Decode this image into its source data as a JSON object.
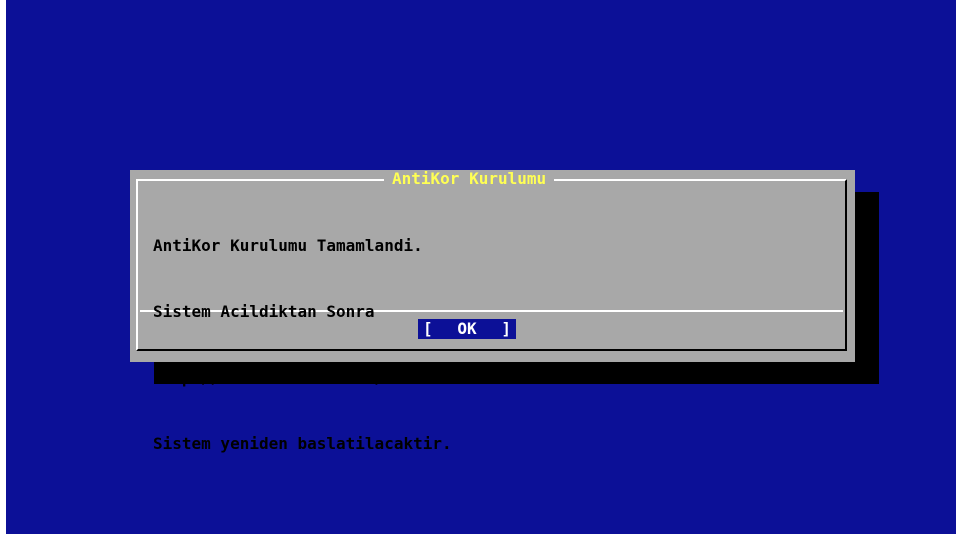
{
  "dialog": {
    "title": "AntiKor Kurulumu",
    "message": [
      "AntiKor Kurulumu Tamamlandi.",
      "Sistem Acildiktan Sonra",
      "http://192.168.2.254:88/ adresinden erisebilirsiniz.",
      "Sistem yeniden baslatilacaktir."
    ],
    "ok_button": {
      "left_bracket": "[",
      "label": "OK",
      "right_bracket": "]"
    }
  },
  "colors": {
    "background": "#0c1097",
    "dialog": "#a8a8a8",
    "title": "#ffff54",
    "shadow": "#000000"
  }
}
